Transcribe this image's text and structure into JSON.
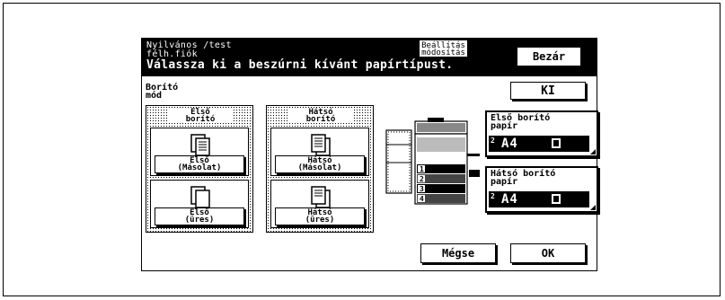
{
  "header": {
    "line1": "Nyilvános /test\nfélh.fiók",
    "settings_label": "Beállítás\nmódosítás",
    "instruction": "Válassza ki a beszúrni kívánt papírtípust.",
    "close_label": "Bezár"
  },
  "mode": {
    "title": "Borító\nmód",
    "off_label": "KI"
  },
  "front_group": {
    "title": "Első\nborító",
    "copy_label": "Első\n(Másolat)",
    "blank_label": "Első\n(üres)"
  },
  "back_group": {
    "title": "Hátsó\nborító",
    "copy_label": "Hátsó\n(Másolat)",
    "blank_label": "Hátsó\n(üres)"
  },
  "machine": {
    "trays": [
      "1",
      "2",
      "3",
      "4"
    ]
  },
  "front_paper": {
    "label": "Első borító\npapír",
    "tray": "2",
    "size": "A4"
  },
  "back_paper": {
    "label": "Hátsó borító\npapír",
    "tray": "2",
    "size": "A4"
  },
  "footer": {
    "cancel_label": "Mégse",
    "ok_label": "OK"
  }
}
